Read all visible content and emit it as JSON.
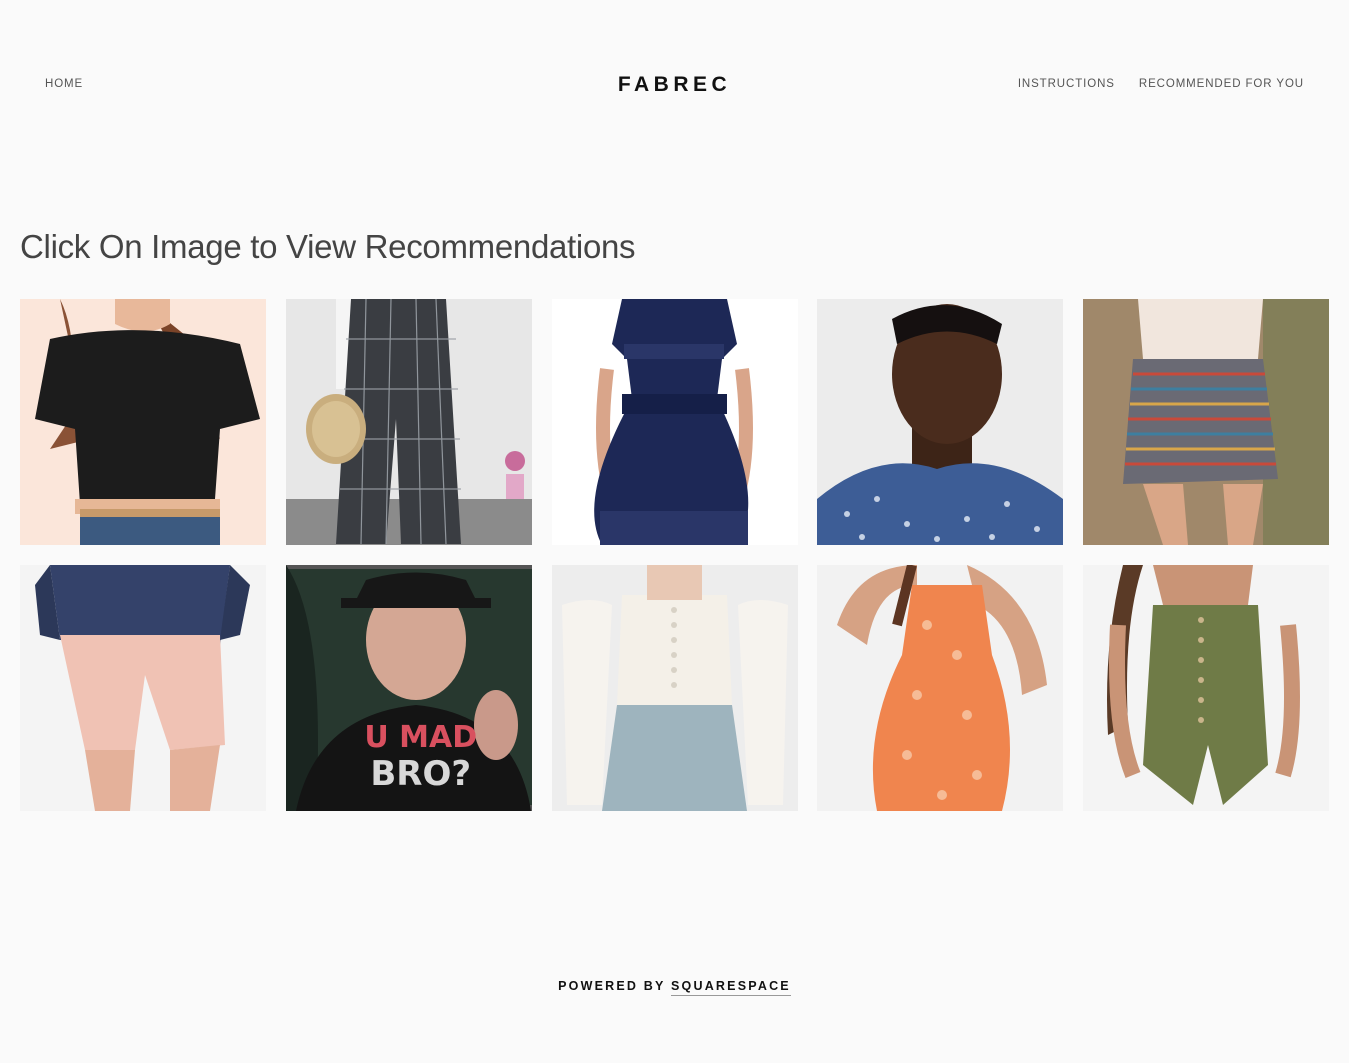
{
  "header": {
    "logo": "FABREC",
    "nav_left": {
      "home": "HOME"
    },
    "nav_right": {
      "instructions": "INSTRUCTIONS",
      "recommended": "RECOMMENDED FOR YOU"
    }
  },
  "main": {
    "title": "Click On Image to View Recommendations",
    "tiles": [
      {
        "name": "black-crop-top-photo"
      },
      {
        "name": "plaid-wide-pants-photo"
      },
      {
        "name": "navy-dress-photo"
      },
      {
        "name": "floral-shirt-man-photo"
      },
      {
        "name": "striped-mini-skirt-photo"
      },
      {
        "name": "pink-shorts-photo"
      },
      {
        "name": "u-mad-bro-shirt-photo",
        "text_line1": "U MAD",
        "text_line2": "BRO?"
      },
      {
        "name": "white-corset-top-photo"
      },
      {
        "name": "orange-floral-dress-photo"
      },
      {
        "name": "olive-romper-photo"
      }
    ]
  },
  "footer": {
    "prefix": "POWERED BY",
    "link": "SQUARESPACE"
  }
}
